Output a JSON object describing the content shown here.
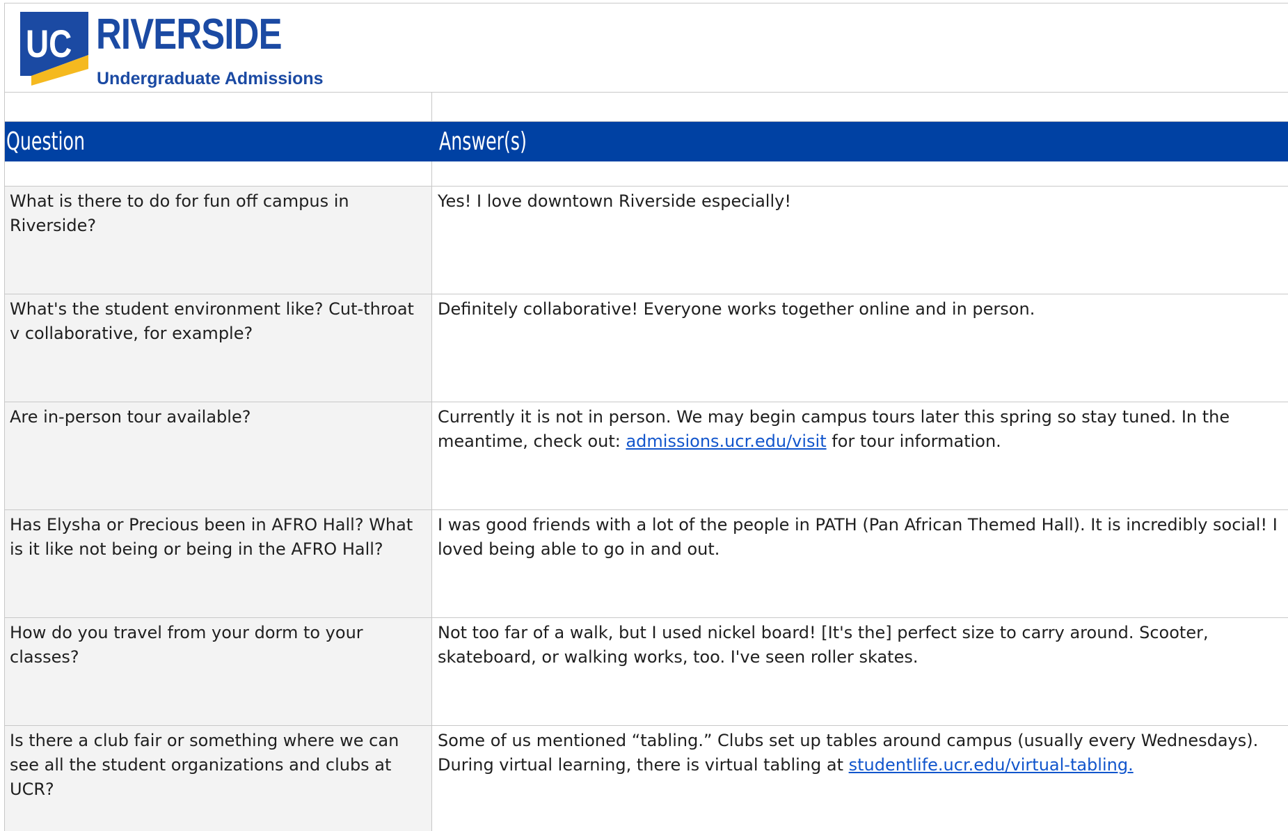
{
  "logo": {
    "mark": "UC",
    "name": "RIVERSIDE",
    "subtitle": "Undergraduate Admissions",
    "colors": {
      "navy": "#1b4aa3",
      "gold": "#f5b91f"
    }
  },
  "header": {
    "question_label": "Question",
    "answer_label": "Answer(s)",
    "background": "#0041a3"
  },
  "rows": [
    {
      "question": "What is there to do for fun off campus in Riverside?",
      "answer_before": "Yes! I love downtown Riverside especially!",
      "link": "",
      "answer_after": ""
    },
    {
      "question": "What's the student environment like? Cut-throat v collaborative, for example?",
      "answer_before": "Definitely collaborative! Everyone works together online and in person.",
      "link": "",
      "answer_after": ""
    },
    {
      "question": "Are in-person tour available?",
      "answer_before": "Currently it is not in person. We may begin campus tours later this spring so stay tuned. In the meantime, check out: ",
      "link": "admissions.ucr.edu/visit",
      "answer_after": " for tour information."
    },
    {
      "question": "Has Elysha or Precious been in AFRO Hall? What is it like not being or being in the AFRO Hall?",
      "answer_before": "I was good friends with a lot of the people in PATH (Pan African Themed Hall). It is incredibly social! I loved being able to go in and out.",
      "link": "",
      "answer_after": ""
    },
    {
      "question": "How do you travel from your dorm to your classes?",
      "answer_before": "Not too far of a walk, but I used nickel board! [It's the] perfect size to carry around. Scooter, skateboard, or walking works, too. I've seen roller skates.",
      "link": "",
      "answer_after": ""
    },
    {
      "question": "Is there a club fair or something where we can see all the student organizations and clubs at UCR?",
      "answer_before": "Some of us mentioned “tabling.” Clubs set up tables around campus (usually every Wednesdays). During virtual learning, there is virtual tabling at ",
      "link": "studentlife.ucr.edu/virtual-tabling.",
      "answer_after": ""
    }
  ]
}
